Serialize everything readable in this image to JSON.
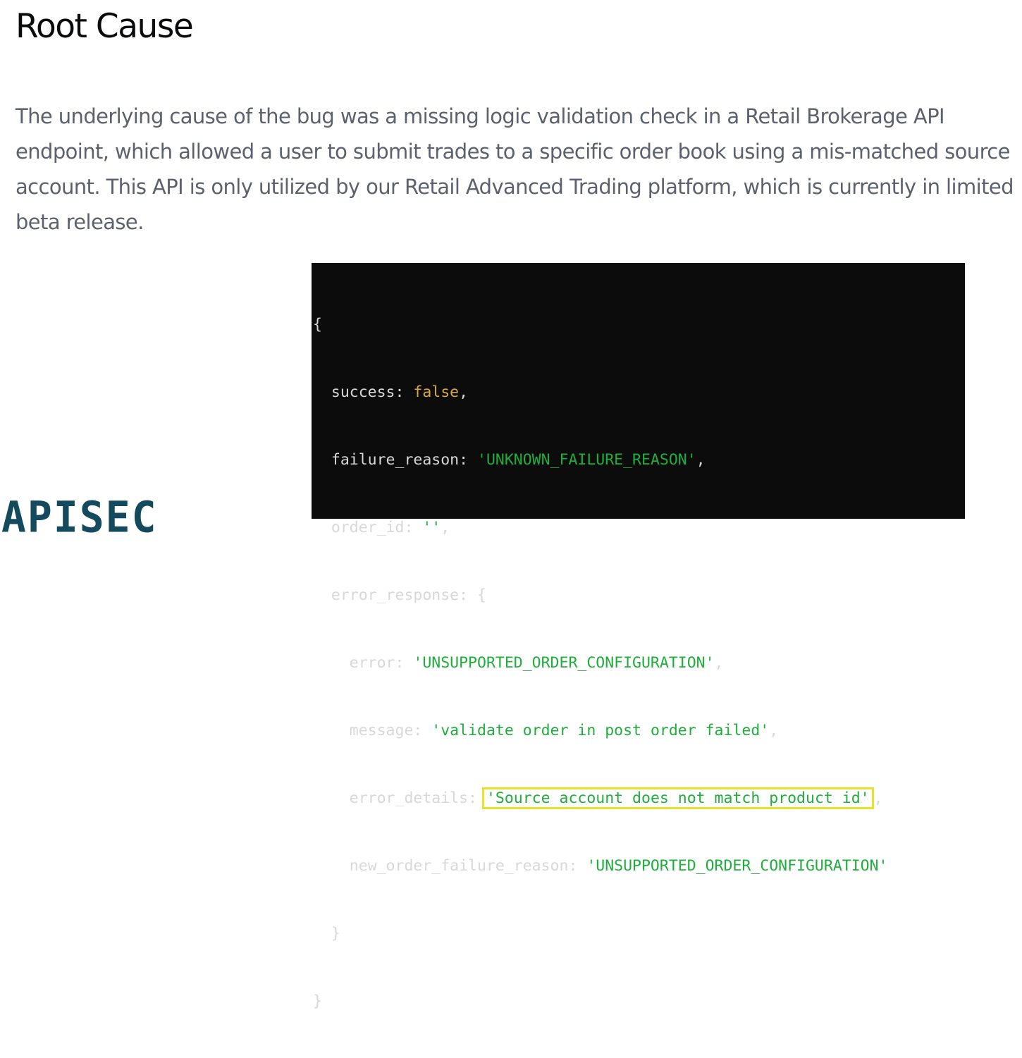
{
  "section": {
    "heading": "Root Cause",
    "paragraph": "The underlying cause of the bug was a missing logic validation check in a Retail Brokerage API endpoint, which allowed a user to submit trades to a specific order book using a mis-matched source account. This API is only utilized by our Retail Advanced Trading platform, which is currently in limited beta release."
  },
  "code": {
    "open_brace": "{",
    "success_key": "success: ",
    "success_value": "false",
    "success_comma": ",",
    "failure_reason_key": "failure_reason: ",
    "failure_reason_value": "'UNKNOWN_FAILURE_REASON'",
    "failure_reason_comma": ",",
    "order_id_key": "order_id: ",
    "order_id_value": "''",
    "order_id_comma": ",",
    "error_response_key": "error_response: {",
    "error_key": "error: ",
    "error_value": "'UNSUPPORTED_ORDER_CONFIGURATION'",
    "error_comma": ",",
    "message_key": "message: ",
    "message_value": "'validate order in post order failed'",
    "message_comma": ",",
    "error_details_key": "error_details: ",
    "error_details_value": "'Source account does not match product id'",
    "error_details_comma": ",",
    "new_order_failure_reason_key": "new_order_failure_reason: ",
    "new_order_failure_reason_value": "'UNSUPPORTED_ORDER_CONFIGURATION'",
    "inner_close_brace": "}",
    "close_brace": "}"
  },
  "logo": {
    "text": "APISEC"
  },
  "colors": {
    "heading": "#0a0b0d",
    "paragraph": "#5b616e",
    "code_background": "#0c0c0c",
    "code_string": "#1eae3a",
    "code_boolean": "#d7a840",
    "highlight_box": "#e8e22a",
    "logo": "#134a5e"
  }
}
